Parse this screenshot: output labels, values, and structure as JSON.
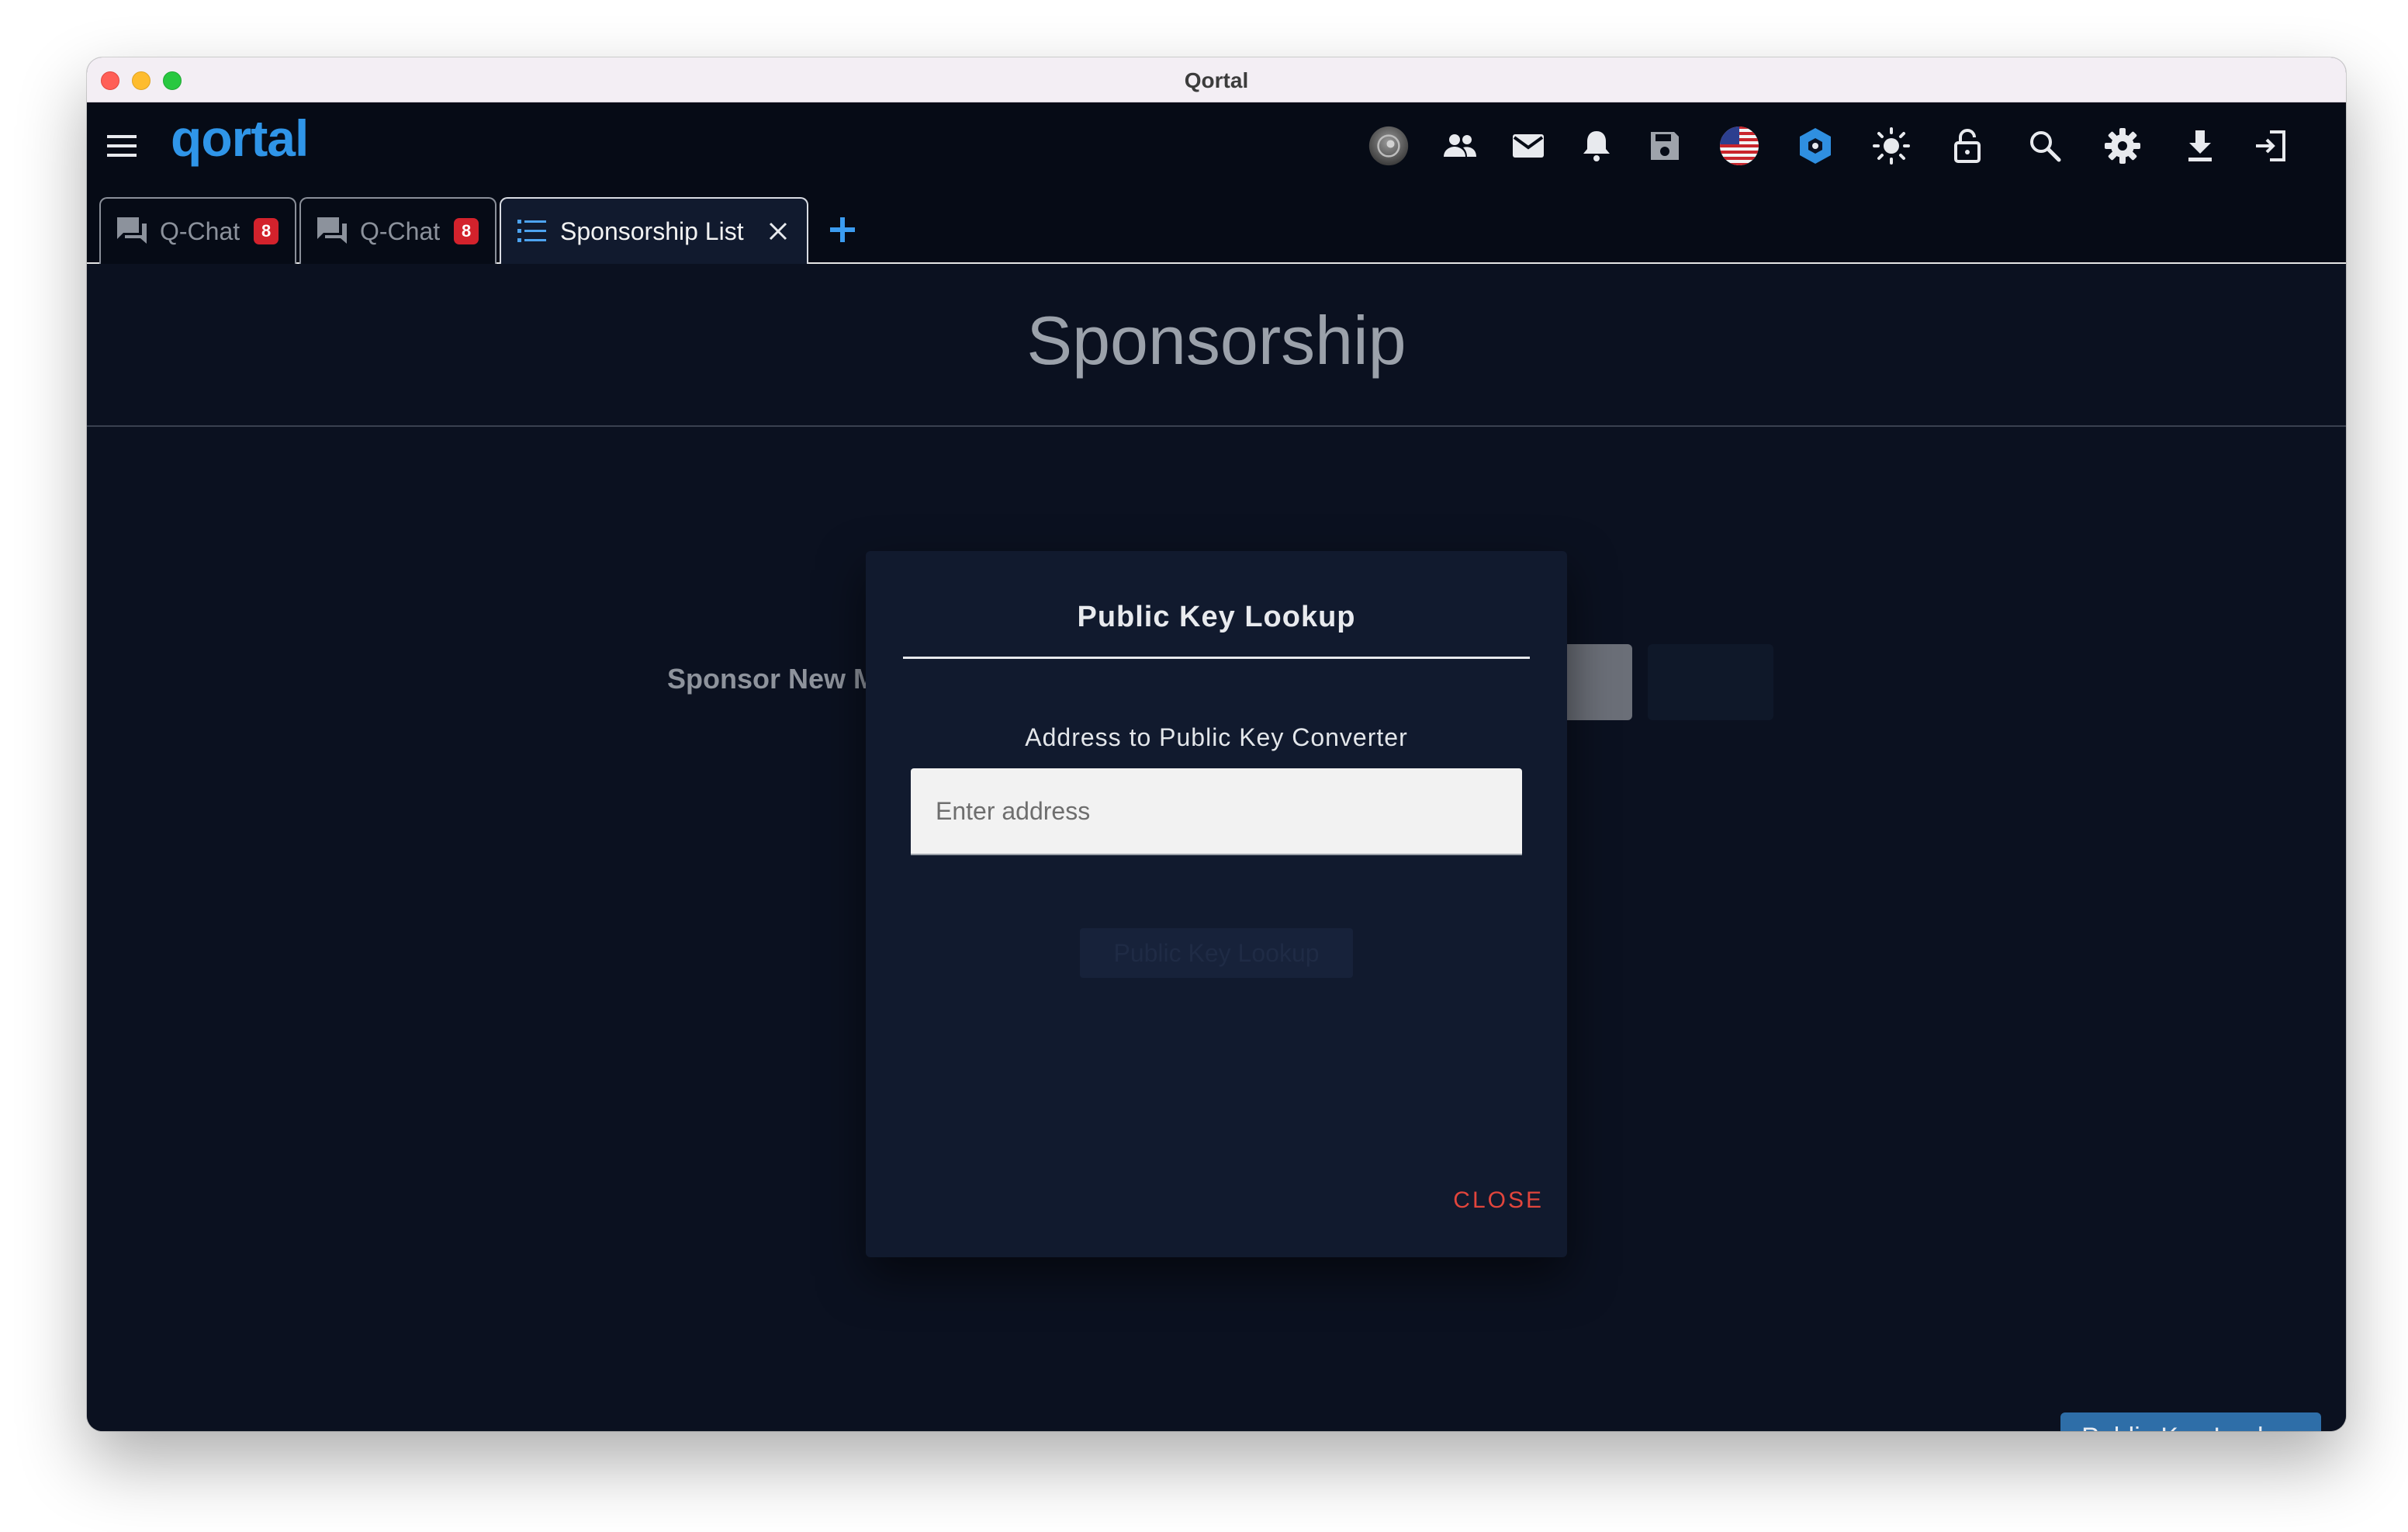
{
  "window": {
    "title": "Qortal"
  },
  "appbar": {
    "logo": "qortal",
    "icons": [
      "avatar-icon",
      "friends-icon",
      "mail-icon",
      "bell-icon",
      "save-icon",
      "us-flag-icon",
      "hexagon-icon",
      "brightness-icon",
      "lock-icon",
      "search-icon",
      "gear-icon",
      "download-icon",
      "logout-icon"
    ]
  },
  "tabs": [
    {
      "label": "Q-Chat",
      "badge": "8",
      "icon": "chat-icon",
      "active": false
    },
    {
      "label": "Q-Chat",
      "badge": "8",
      "icon": "chat-icon",
      "active": false
    },
    {
      "label": "Sponsorship List",
      "icon": "list-icon",
      "active": true
    }
  ],
  "page": {
    "title": "Sponsorship",
    "sponsor_label": "Sponsor New M",
    "public_key_button": "Public Key Lookup"
  },
  "modal": {
    "title": "Public Key Lookup",
    "subtitle": "Address to Public Key Converter",
    "input_placeholder": "Enter address",
    "lookup_button": "Public Key Lookup",
    "close_button": "CLOSE"
  },
  "colors": {
    "accent": "#2f95e8",
    "badge": "#d3222c",
    "close": "#e2453c",
    "background": "#0b1120"
  }
}
